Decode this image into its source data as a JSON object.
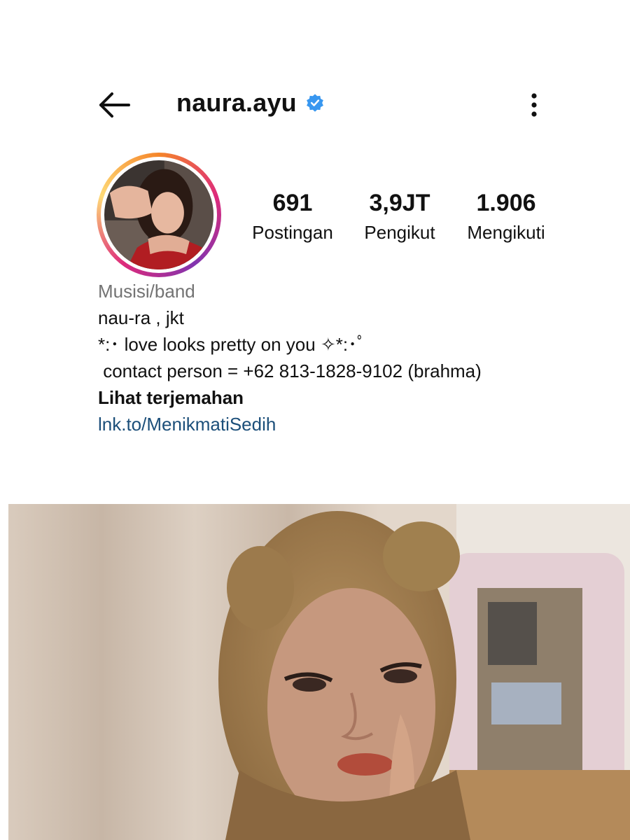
{
  "header": {
    "username": "naura.ayu",
    "back_icon": "arrow-left-icon",
    "verified_icon": "verified-badge-icon",
    "menu_icon": "more-vertical-icon"
  },
  "stats": [
    {
      "value": "691",
      "label": "Postingan"
    },
    {
      "value": "3,9JT",
      "label": "Pengikut"
    },
    {
      "value": "1.906",
      "label": "Mengikuti"
    }
  ],
  "bio": {
    "category": "Musisi/band",
    "name_line": "nau-ra , jkt",
    "line1": "*:･ love looks pretty on you ✧*:･ﾟ",
    "line2": " contact person = +62 813-1828-9102 (brahma)",
    "translate": "Lihat terjemahan",
    "link": "lnk.to/MenikmatiSedih"
  },
  "colors": {
    "link": "#1c4f7a",
    "verified": "#3897f0",
    "muted": "#737373"
  }
}
